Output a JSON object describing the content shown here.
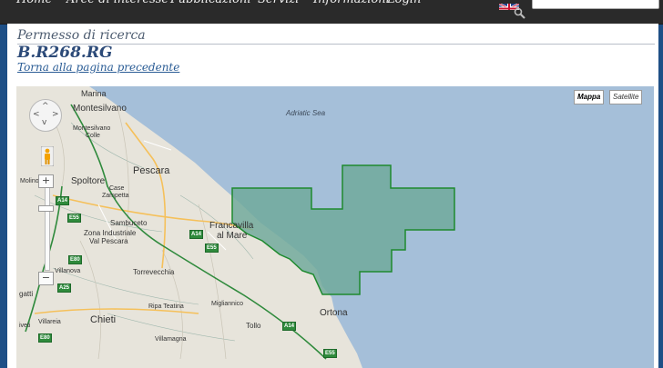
{
  "nav": {
    "items": [
      "Home",
      "Aree di interesse",
      "Pubblicazioni",
      "Servizi",
      "Informazioni",
      "Login"
    ],
    "search": {
      "value": ""
    }
  },
  "page": {
    "section_title": "Permesso di ricerca",
    "permit_code": "B.R268.RG",
    "back_link": "Torna alla pagina precedente"
  },
  "map": {
    "type_buttons": {
      "map": "Mappa",
      "satellite": "Satellite"
    },
    "sea_label": "Adriatic Sea",
    "places": [
      {
        "name": "Marina",
        "size": 9
      },
      {
        "name": "Montesilvano",
        "size": 10
      },
      {
        "name": "Montesilvano",
        "size": 7
      },
      {
        "name": "Colle",
        "size": 7
      },
      {
        "name": "Pescara",
        "size": 11
      },
      {
        "name": "Molino",
        "size": 7
      },
      {
        "name": "Spoltore",
        "size": 10
      },
      {
        "name": "Case",
        "size": 7
      },
      {
        "name": "Zampetta",
        "size": 7
      },
      {
        "name": "Sambuceto",
        "size": 8
      },
      {
        "name": "Zona Industriale",
        "size": 8
      },
      {
        "name": "Val Pescara",
        "size": 8
      },
      {
        "name": "Francavilla",
        "size": 10
      },
      {
        "name": "al Mare",
        "size": 10
      },
      {
        "name": "Villanova",
        "size": 7
      },
      {
        "name": "Torrevecchia",
        "size": 8
      },
      {
        "name": "gatti",
        "size": 8
      },
      {
        "name": "Migliannico",
        "size": 7
      },
      {
        "name": "Ripa Teatina",
        "size": 7
      },
      {
        "name": "Ortona",
        "size": 10
      },
      {
        "name": "Chieti",
        "size": 11
      },
      {
        "name": "Villareia",
        "size": 7
      },
      {
        "name": "iveti",
        "size": 7
      },
      {
        "name": "Tollo",
        "size": 8
      },
      {
        "name": "Villamagna",
        "size": 7
      }
    ],
    "roads": [
      "A14",
      "E55",
      "A14",
      "E55",
      "E80",
      "A25",
      "E80",
      "A14",
      "E55"
    ],
    "colors": {
      "sea": "#a5bfd9",
      "land": "#e5e2d8",
      "permit_fill": "#6ea89a",
      "permit_stroke": "#1e8a2e",
      "road_badge": "#2f8a3c"
    }
  }
}
